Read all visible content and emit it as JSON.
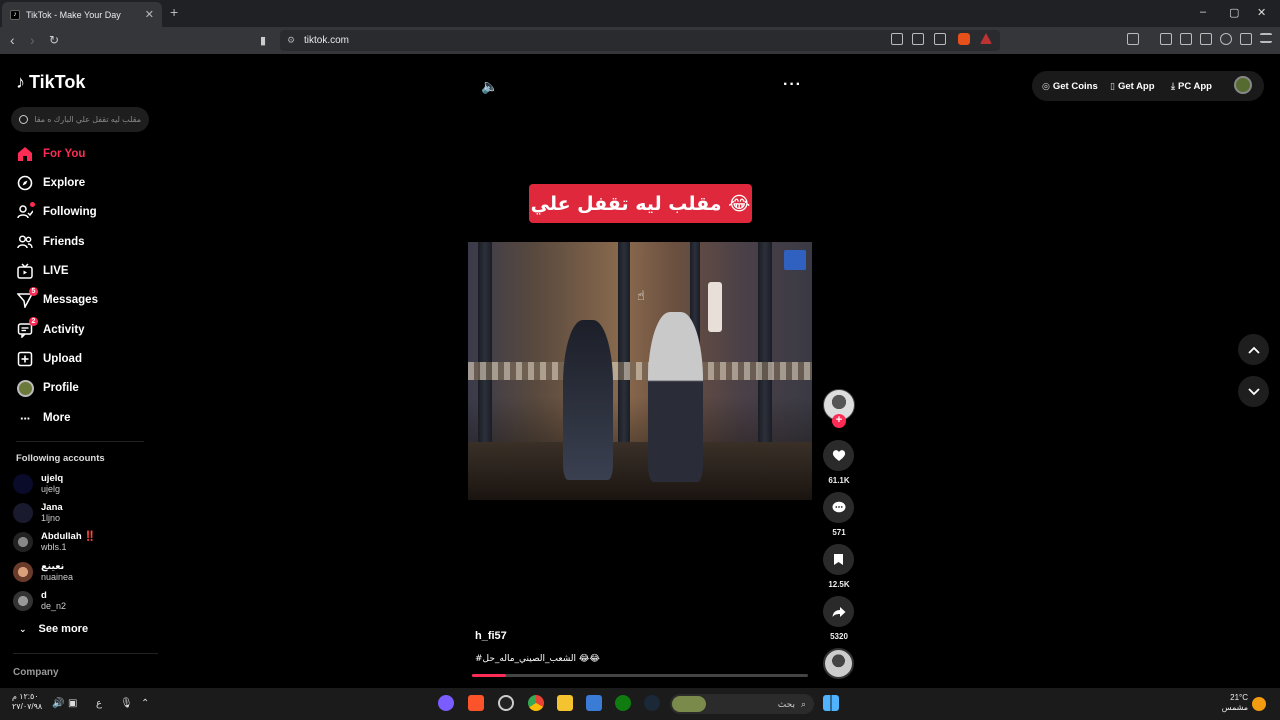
{
  "browser": {
    "tab_title": "TikTok - Make Your Day",
    "tab_close": "✕",
    "new_tab": "+",
    "url": "tiktok.com",
    "window_controls": [
      "–",
      "▢",
      "✕"
    ]
  },
  "sidebar": {
    "logo": "TikTok",
    "search_placeholder": "مقلب ليه تقفل علي البارك ه مقالب",
    "nav": [
      {
        "label": "For You",
        "icon": "home-icon",
        "active": true
      },
      {
        "label": "Explore",
        "icon": "compass-icon"
      },
      {
        "label": "Following",
        "icon": "following-icon"
      },
      {
        "label": "Friends",
        "icon": "friends-icon"
      },
      {
        "label": "LIVE",
        "icon": "live-icon"
      },
      {
        "label": "Messages",
        "icon": "messages-icon",
        "badge": "5"
      },
      {
        "label": "Activity",
        "icon": "activity-icon",
        "badge": "2"
      },
      {
        "label": "Upload",
        "icon": "upload-icon"
      },
      {
        "label": "Profile",
        "icon": "profile-icon"
      },
      {
        "label": "More",
        "icon": "more-icon"
      }
    ],
    "following_title": "Following accounts",
    "accounts": [
      {
        "name": "ujelq",
        "handle": "ujelg"
      },
      {
        "name": "Jana",
        "handle": "1ljno"
      },
      {
        "name": "Abdullah ‼️",
        "handle": "wbls.1"
      },
      {
        "name": "نعينع",
        "handle": "nuainea"
      },
      {
        "name": "d",
        "handle": "de_n2"
      }
    ],
    "see_more": "See more",
    "company": "Company"
  },
  "top": {
    "get_coins": "Get Coins",
    "get_app": "Get App",
    "pc_app": "PC App"
  },
  "video": {
    "overlay_caption": "مقلب ليه تقفل علي 😂",
    "username": "h_fi57",
    "description": "#الشعب_الصيني_ماله_حل 😂😂",
    "progress": 0.1
  },
  "actions": {
    "likes": "61.1K",
    "comments": "571",
    "saves": "12.5K",
    "shares": "5320"
  },
  "taskbar": {
    "time": "١٢:٥٠ م",
    "date": "٢٧/٠٧/٩٨",
    "search_label": "بحث",
    "temp": "21°C",
    "weather_text": "مشمس",
    "lang": "ع"
  },
  "colors": {
    "accent": "#fe2c55",
    "banner": "#e0283c",
    "background": "#000000"
  }
}
